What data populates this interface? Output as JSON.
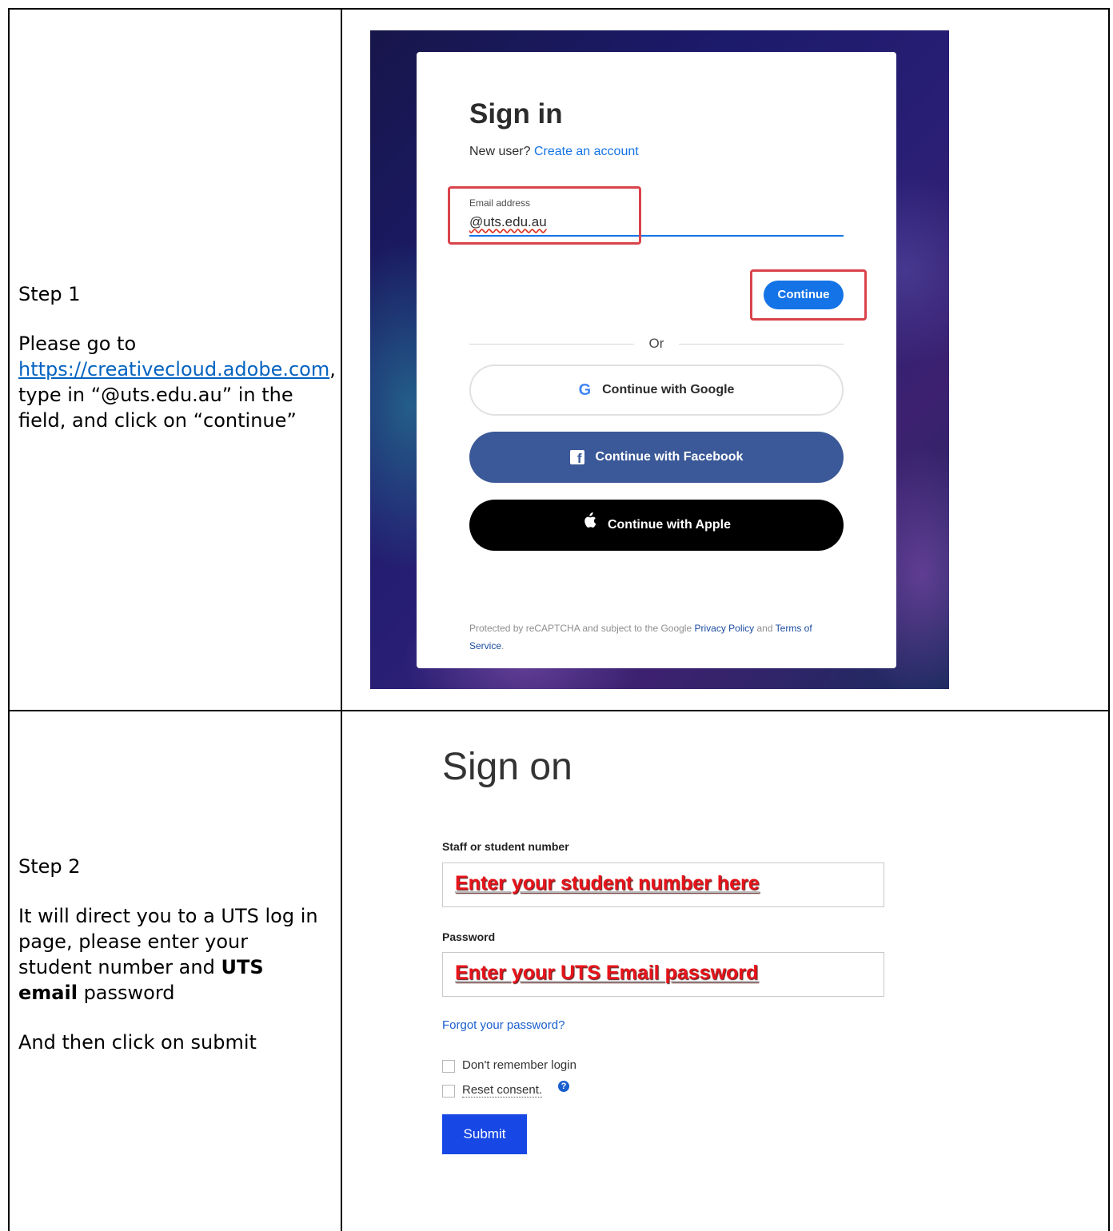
{
  "step1": {
    "heading": "Step 1",
    "text_before": "Please go to ",
    "link": "https://creativecloud.adobe.com",
    "text_after": ", type in “@uts.edu.au” in the field, and click on “continue”",
    "screenshot": {
      "title": "Sign in",
      "new_user_text": "New user?",
      "create_account_link": "Create an account",
      "email_label": "Email address",
      "email_value": "@uts.edu.au",
      "continue_button": "Continue",
      "or_text": "Or",
      "google_button": "Continue with Google",
      "facebook_button": "Continue with Facebook",
      "apple_button": "Continue with Apple",
      "legal_text_1": "Protected by reCAPTCHA and subject to the Google ",
      "privacy_link": "Privacy Policy",
      "legal_and": " and ",
      "terms_link": "Terms of Service",
      "legal_end": ".",
      "colors": {
        "accent": "#1473e6",
        "highlight": "#d9434a",
        "facebook": "#3b5998"
      }
    }
  },
  "step2": {
    "heading": "Step 2",
    "text_line1": "It will direct you to a UTS log in page, please enter your student number and ",
    "bold_text": "UTS email",
    "text_line2": " password",
    "text_line3": "And then click on submit",
    "screenshot": {
      "title": "Sign on",
      "username_label": "Staff or student number",
      "username_placeholder": "Enter your student number here",
      "password_label": "Password",
      "password_placeholder": "Enter your UTS Email password",
      "forgot_link": "Forgot your password?",
      "dont_remember_label": "Don't remember login",
      "reset_consent_label": "Reset consent.",
      "help_icon": "question-circle-icon",
      "submit_button": "Submit",
      "colors": {
        "placeholder": "#e8141b",
        "submit": "#1747e5",
        "link": "#1a5fcf"
      }
    }
  }
}
